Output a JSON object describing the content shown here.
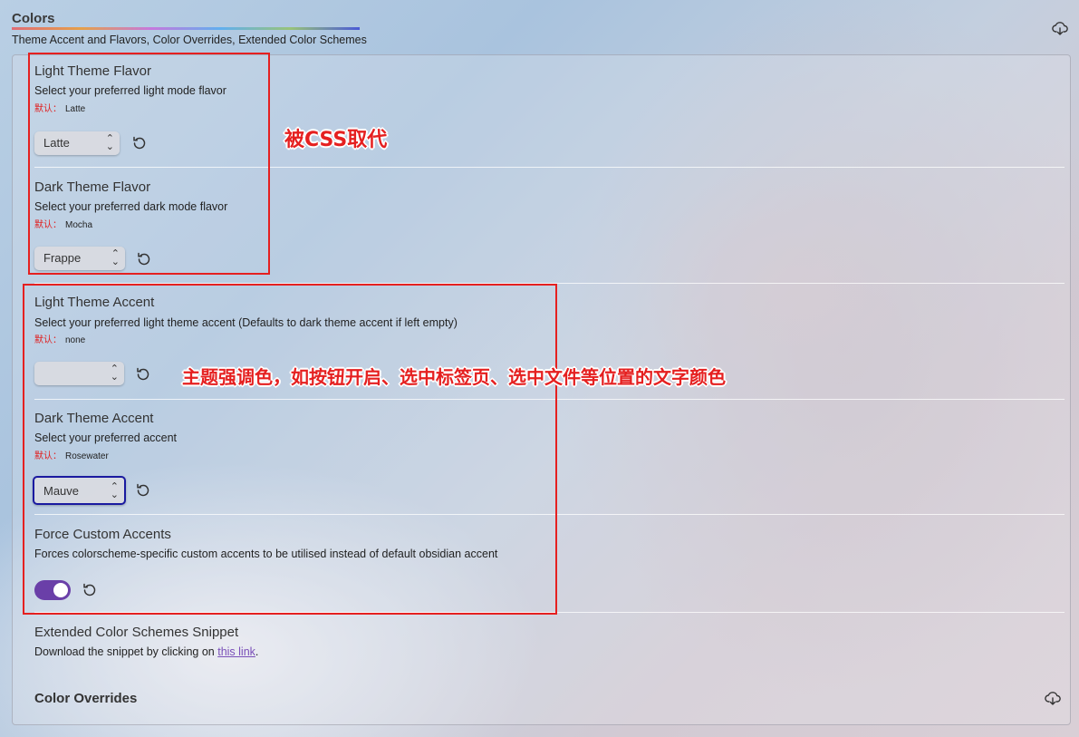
{
  "header": {
    "title": "Colors",
    "subtitle": "Theme Accent and Flavors, Color Overrides, Extended Color Schemes",
    "download_icon": "download-cloud-icon"
  },
  "default_label": "默认：",
  "settings": {
    "light_flavor": {
      "name": "Light Theme Flavor",
      "desc": "Select your preferred light mode flavor",
      "default": "Latte",
      "value": "Latte"
    },
    "dark_flavor": {
      "name": "Dark Theme Flavor",
      "desc": "Select your preferred dark mode flavor",
      "default": "Mocha",
      "value": "Frappe"
    },
    "light_accent": {
      "name": "Light Theme Accent",
      "desc": "Select your preferred light theme accent (Defaults to dark theme accent if left empty)",
      "default": "none",
      "value": ""
    },
    "dark_accent": {
      "name": "Dark Theme Accent",
      "desc": "Select your preferred accent",
      "default": "Rosewater",
      "value": "Mauve"
    },
    "force_custom": {
      "name": "Force Custom Accents",
      "desc": "Forces colorscheme-specific custom accents to be utilised instead of default obsidian accent",
      "enabled": true
    },
    "extended": {
      "name": "Extended Color Schemes Snippet",
      "desc_prefix": "Download the snippet by clicking on ",
      "link_text": "this link",
      "desc_suffix": "."
    }
  },
  "color_overrides": {
    "title": "Color Overrides"
  },
  "annotations": {
    "flavor_note": "被CSS取代",
    "accent_note": "主题强调色，如按钮开启、选中标签页、选中文件等位置的文字颜色"
  },
  "colors": {
    "annotation_red": "#e52020",
    "toggle_purple": "#6a3fa8",
    "focus_blue": "#1a1aa0",
    "link": "#7a4fb8"
  }
}
